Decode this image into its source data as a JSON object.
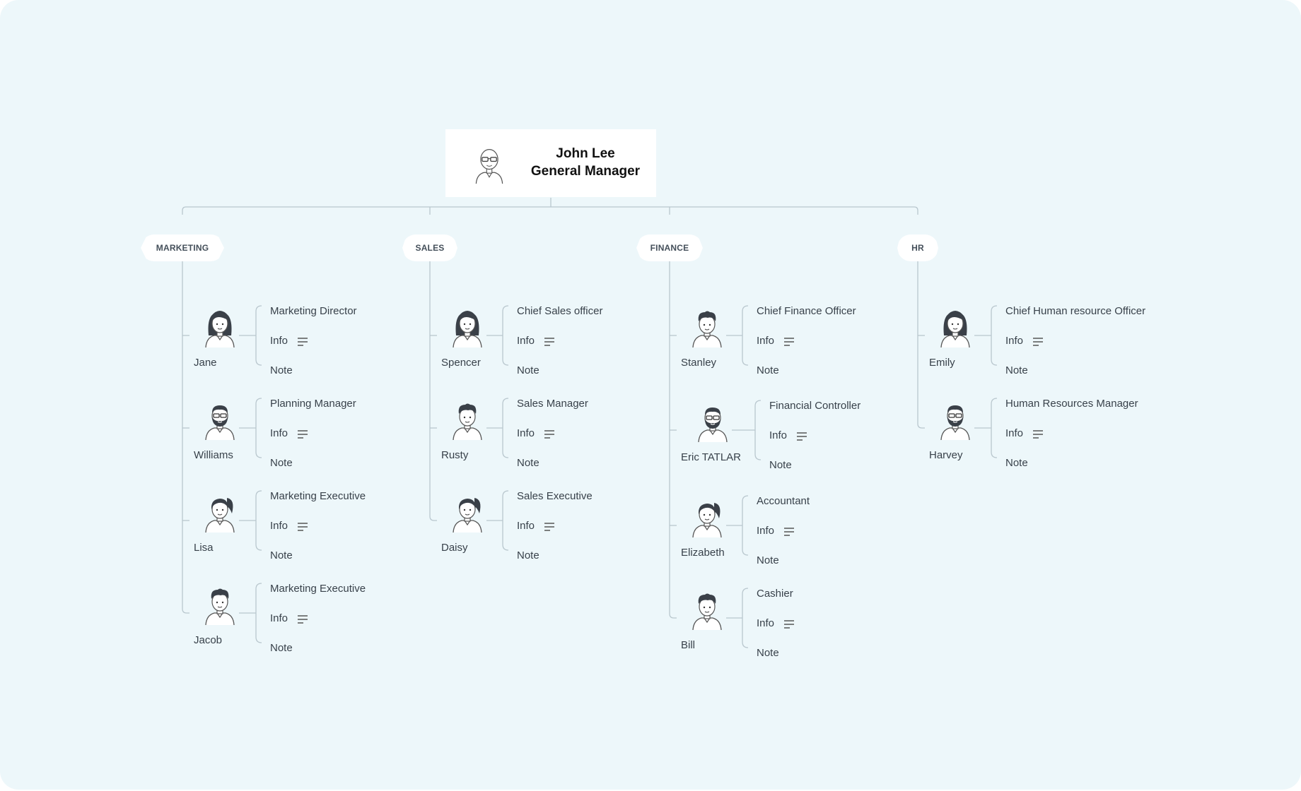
{
  "root": {
    "name": "John Lee",
    "title": "General Manager",
    "avatar": "bald-glasses-man-icon"
  },
  "departments": [
    {
      "name": "MARKETING",
      "members": [
        {
          "name": "Jane",
          "role": "Marketing Director",
          "info": "Info",
          "note": "Note",
          "avatar": "long-hair-woman-icon"
        },
        {
          "name": "Williams",
          "role": "Planning Manager",
          "info": "Info",
          "note": "Note",
          "avatar": "bearded-glasses-man-icon"
        },
        {
          "name": "Lisa",
          "role": "Marketing Executive",
          "info": "Info",
          "note": "Note",
          "avatar": "ponytail-woman-icon"
        },
        {
          "name": "Jacob",
          "role": "Marketing Executive",
          "info": "Info",
          "note": "Note",
          "avatar": "curly-hair-man-icon"
        }
      ]
    },
    {
      "name": "SALES",
      "members": [
        {
          "name": "Spencer",
          "role": "Chief Sales officer",
          "info": "Info",
          "note": "Note",
          "avatar": "long-hair-woman-icon"
        },
        {
          "name": "Rusty",
          "role": "Sales Manager",
          "info": "Info",
          "note": "Note",
          "avatar": "curly-hair-man-icon"
        },
        {
          "name": "Daisy",
          "role": "Sales Executive",
          "info": "Info",
          "note": "Note",
          "avatar": "ponytail-woman-icon"
        }
      ]
    },
    {
      "name": "FINANCE",
      "members": [
        {
          "name": "Stanley",
          "role": "Chief Finance Officer",
          "info": "Info",
          "note": "Note",
          "avatar": "curly-hair-man-icon"
        },
        {
          "name": "Eric TATLAR",
          "role": "Financial Controller",
          "info": "Info",
          "note": "Note",
          "avatar": "bearded-glasses-man-icon"
        },
        {
          "name": "Elizabeth",
          "role": "Accountant",
          "info": "Info",
          "note": "Note",
          "avatar": "ponytail-woman-icon"
        },
        {
          "name": "Bill",
          "role": "Cashier",
          "info": "Info",
          "note": "Note",
          "avatar": "curly-hair-man-icon"
        }
      ]
    },
    {
      "name": "HR",
      "members": [
        {
          "name": "Emily",
          "role": "Chief Human resource Officer",
          "info": "Info",
          "note": "Note",
          "avatar": "long-hair-woman-icon"
        },
        {
          "name": "Harvey",
          "role": "Human Resources Manager",
          "info": "Info",
          "note": "Note",
          "avatar": "bearded-glasses-man-icon"
        }
      ]
    }
  ],
  "colors": {
    "background": "#edf7fa",
    "connector": "#b9c7ce",
    "text": "#38414a",
    "hair": "#3a4048"
  }
}
